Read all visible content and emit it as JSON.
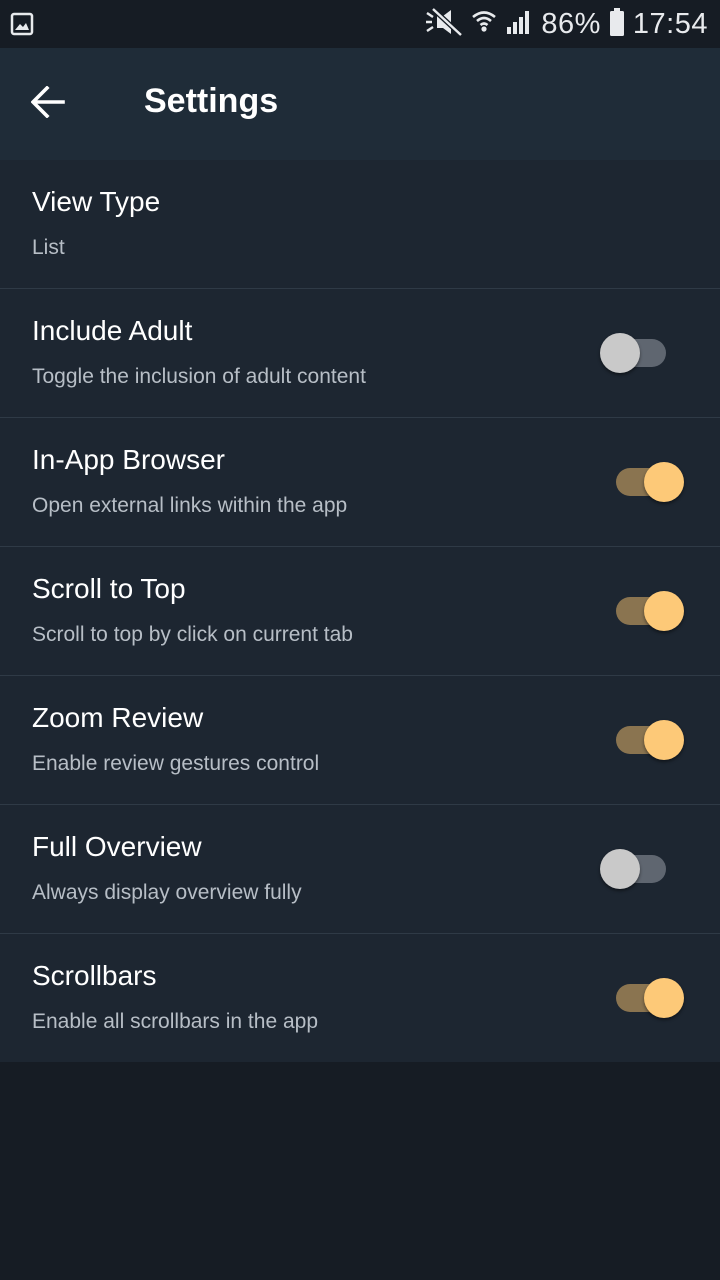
{
  "status_bar": {
    "battery_percent": "86%",
    "time": "17:54",
    "icons": [
      "image-icon",
      "mute-icon",
      "wifi-icon",
      "signal-icon",
      "battery-icon"
    ]
  },
  "app_bar": {
    "back_icon": "arrow-left-icon",
    "title": "Settings"
  },
  "settings": [
    {
      "title": "View Type",
      "subtitle": "List"
    },
    {
      "title": "Include Adult",
      "subtitle": "Toggle the inclusion of adult content",
      "enabled": false
    },
    {
      "title": "In-App Browser",
      "subtitle": "Open external links within the app",
      "enabled": true
    },
    {
      "title": "Scroll to Top",
      "subtitle": "Scroll to top by click on current tab",
      "enabled": true
    },
    {
      "title": "Zoom Review",
      "subtitle": "Enable review gestures control",
      "enabled": true
    },
    {
      "title": "Full Overview",
      "subtitle": "Always display overview fully",
      "enabled": false
    },
    {
      "title": "Scrollbars",
      "subtitle": "Enable all scrollbars in the app",
      "enabled": true
    }
  ],
  "colors": {
    "accent": "#fdc978",
    "app_bar": "#1f2c38",
    "background": "#161c24"
  }
}
